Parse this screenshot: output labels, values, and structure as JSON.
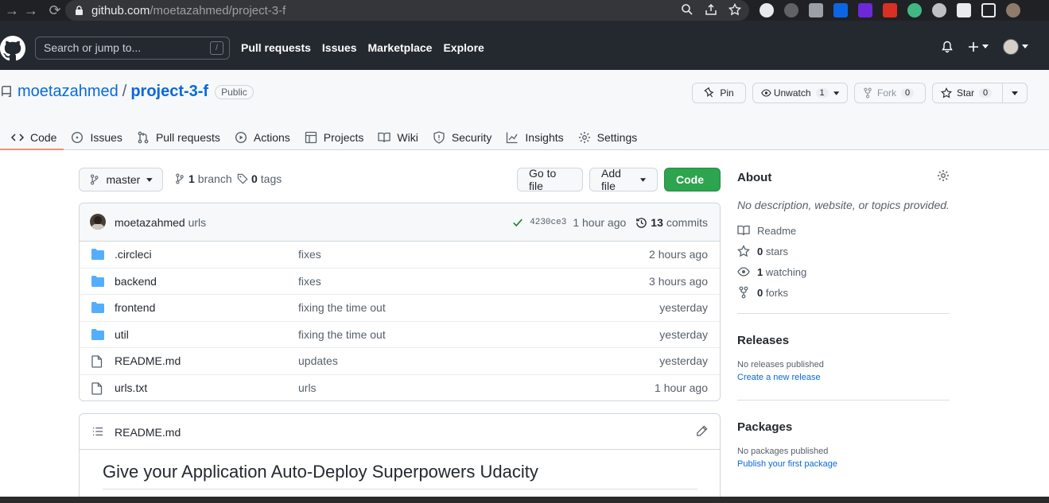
{
  "browser": {
    "url_host": "github.com",
    "url_path": "/moetazahmed/project-3-f"
  },
  "header": {
    "search_placeholder": "Search or jump to...",
    "search_shortcut": "/",
    "nav": [
      "Pull requests",
      "Issues",
      "Marketplace",
      "Explore"
    ]
  },
  "repo": {
    "owner": "moetazahmed",
    "separator": "/",
    "name": "project-3-f",
    "visibility": "Public",
    "pin_label": "Pin",
    "unwatch_label": "Unwatch",
    "watch_count": "1",
    "fork_label": "Fork",
    "fork_count": "0",
    "star_label": "Star",
    "star_count": "0"
  },
  "tabs": [
    {
      "label": "Code",
      "icon": "code-icon",
      "active": true
    },
    {
      "label": "Issues",
      "icon": "issue-icon"
    },
    {
      "label": "Pull requests",
      "icon": "pull-request-icon"
    },
    {
      "label": "Actions",
      "icon": "play-icon"
    },
    {
      "label": "Projects",
      "icon": "table-icon"
    },
    {
      "label": "Wiki",
      "icon": "book-icon"
    },
    {
      "label": "Security",
      "icon": "shield-icon"
    },
    {
      "label": "Insights",
      "icon": "graph-icon"
    },
    {
      "label": "Settings",
      "icon": "gear-icon"
    }
  ],
  "toolbar": {
    "branch": "master",
    "branches_count": "1",
    "branches_label": "branch",
    "tags_count": "0",
    "tags_label": "tags",
    "go_to_file": "Go to file",
    "add_file": "Add file",
    "code": "Code"
  },
  "latest_commit": {
    "author": "moetazahmed",
    "message": "urls",
    "sha": "4230ce3",
    "time": "1 hour ago",
    "commits_count": "13",
    "commits_label": "commits"
  },
  "files": [
    {
      "name": ".circleci",
      "type": "dir",
      "message": "fixes",
      "age": "2 hours ago"
    },
    {
      "name": "backend",
      "type": "dir",
      "message": "fixes",
      "age": "3 hours ago"
    },
    {
      "name": "frontend",
      "type": "dir",
      "message": "fixing the time out",
      "age": "yesterday"
    },
    {
      "name": "util",
      "type": "dir",
      "message": "fixing the time out",
      "age": "yesterday"
    },
    {
      "name": "README.md",
      "type": "file",
      "message": "updates",
      "age": "yesterday"
    },
    {
      "name": "urls.txt",
      "type": "file",
      "message": "urls",
      "age": "1 hour ago"
    }
  ],
  "readme": {
    "filename": "README.md",
    "heading": "Give your Application Auto-Deploy Superpowers Udacity"
  },
  "about": {
    "title": "About",
    "description": "No description, website, or topics provided.",
    "readme_label": "Readme",
    "stars_count": "0",
    "stars_label": "stars",
    "watching_count": "1",
    "watching_label": "watching",
    "forks_count": "0",
    "forks_label": "forks"
  },
  "releases": {
    "title": "Releases",
    "text": "No releases published",
    "link": "Create a new release"
  },
  "packages": {
    "title": "Packages",
    "text": "No packages published",
    "link": "Publish your first package"
  },
  "colors": {
    "accent_blue": "#0969da",
    "green_button": "#2da44e",
    "header_bg": "#24292f",
    "active_tab_underline": "#fd8c73",
    "folder_blue": "#54aeff"
  }
}
